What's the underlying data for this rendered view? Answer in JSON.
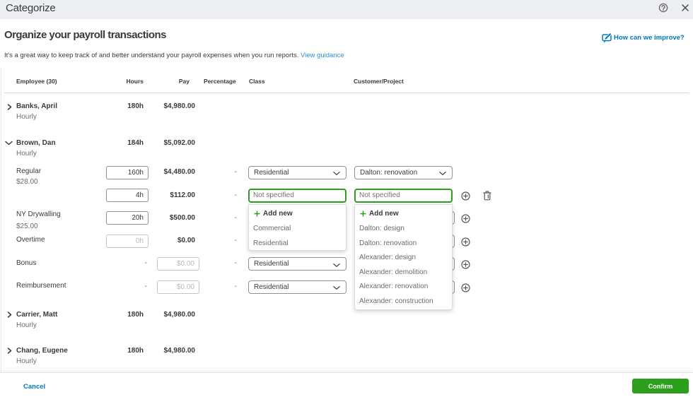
{
  "modal": {
    "title": "Categorize"
  },
  "page": {
    "heading": "Organize your payroll transactions",
    "improve_link": "How can we improve?",
    "subtitle": "It's a great way to keep track of and better understand your payroll expenses when you run reports.",
    "guidance_link": "View guidance"
  },
  "table": {
    "headers": {
      "employee": "Employee (30)",
      "hours": "Hours",
      "pay": "Pay",
      "percentage": "Percentage",
      "class": "Class",
      "customer": "Customer/Project"
    },
    "employees": [
      {
        "name": "Banks, April",
        "type": "Hourly",
        "hours": "180h",
        "pay": "$4,980.00"
      },
      {
        "name": "Brown, Dan",
        "type": "Hourly",
        "hours": "184h",
        "pay": "$5,092.00"
      },
      {
        "name": "Carrier, Matt",
        "type": "Hourly",
        "hours": "180h",
        "pay": "$4,980.00"
      },
      {
        "name": "Chang, Eugene",
        "type": "Hourly",
        "hours": "180h",
        "pay": "$4,980.00"
      }
    ],
    "pay_items": [
      {
        "label": "Regular",
        "rate": "$28.00",
        "hours": "160h",
        "pay": "$4,480.00",
        "percentage": "-",
        "class": "Residential",
        "customer": "Dalton: renovation"
      },
      {
        "label": "",
        "hours": "4h",
        "pay": "$112.00",
        "percentage": "-",
        "class_placeholder": "Not specified",
        "customer_placeholder": "Not specified"
      },
      {
        "label": "NY Drywalling",
        "rate": "$25.00",
        "hours": "20h",
        "pay": "$500.00",
        "percentage": "-"
      },
      {
        "label": "Overtime",
        "hours_placeholder": "0h",
        "pay": "$0.00",
        "percentage": "-"
      },
      {
        "label": "Bonus",
        "hours": "-",
        "pay_placeholder": "$0.00",
        "percentage": "-",
        "class": "Residential"
      },
      {
        "label": "Reimbursement",
        "hours": "-",
        "pay_placeholder": "$0.00",
        "percentage": "-",
        "class": "Residential"
      }
    ],
    "class_menu": {
      "add_new": "Add new",
      "options": [
        "Commercial",
        "Residential"
      ]
    },
    "customer_menu": {
      "add_new": "Add new",
      "options": [
        "Dalton: design",
        "Dalton: renovation",
        "Alexander: design",
        "Alexander: demolition",
        "Alexander: renovation",
        "Alexander: construction"
      ]
    }
  },
  "footer": {
    "cancel": "Cancel",
    "confirm": "Confirm"
  },
  "colors": {
    "green": "#2ca01c",
    "blue": "#0077c5",
    "text": "#393a3d",
    "muted": "#6b6c72"
  }
}
